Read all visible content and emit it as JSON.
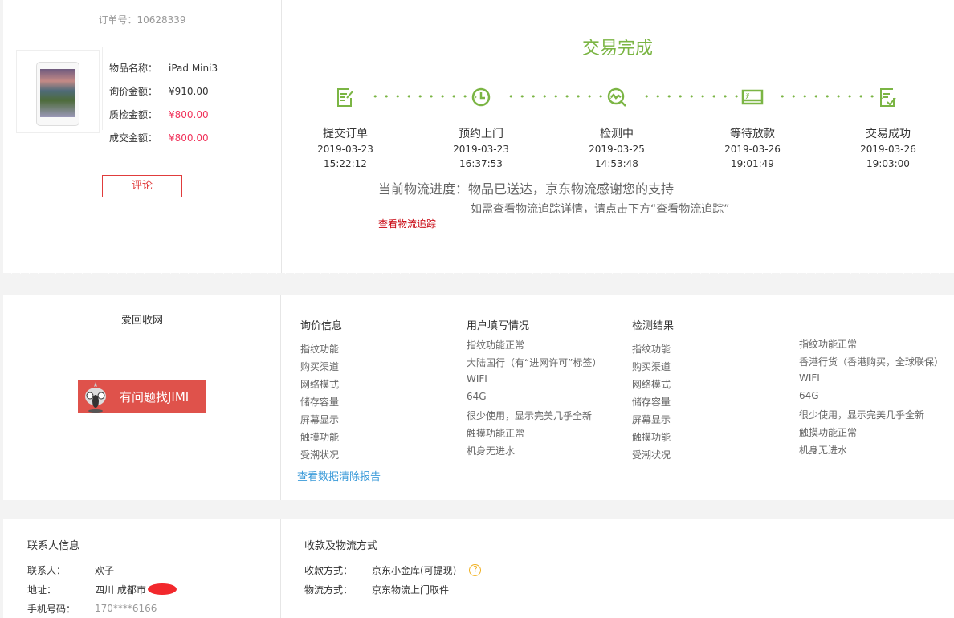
{
  "order": {
    "number_label": "订单号：10628339",
    "fields": [
      {
        "label": "物品名称：",
        "value": "iPad Mini3"
      },
      {
        "label": "询价金额：",
        "value": "¥910.00"
      },
      {
        "label": "质检金额：",
        "value": "¥800.00"
      },
      {
        "label": "成交金额：",
        "value": "¥800.00"
      }
    ],
    "comment_button": "评论"
  },
  "status": {
    "title": "交易完成",
    "steps": [
      {
        "label": "提交订单",
        "date": "2019-03-23",
        "time": "15:22:12",
        "icon": "edit-doc-icon"
      },
      {
        "label": "预约上门",
        "date": "2019-03-23",
        "time": "16:37:53",
        "icon": "clock-icon"
      },
      {
        "label": "检测中",
        "date": "2019-03-25",
        "time": "14:53:48",
        "icon": "inspect-icon"
      },
      {
        "label": "等待放款",
        "date": "2019-03-26",
        "time": "19:01:49",
        "icon": "card-icon"
      },
      {
        "label": "交易成功",
        "date": "2019-03-26",
        "time": "19:03:00",
        "icon": "check-doc-icon"
      }
    ],
    "logistics": "当前物流进度：物品已送达，京东物流感谢您的支持",
    "hint": "如需查看物流追踪详情，请点击下方“查看物流追踪”",
    "track_link": "查看物流追踪",
    "accent": "#7bb544"
  },
  "site": {
    "name": "爱回收网",
    "jimi_button": "有问题找JIMI"
  },
  "inspection": {
    "inquiry": {
      "title": "询价信息",
      "items": [
        "指纹功能",
        "购买渠道",
        "网络模式",
        "储存容量",
        "屏幕显示",
        "触摸功能",
        "受潮状况"
      ]
    },
    "user": {
      "title": "用户填写情况",
      "items": [
        "指纹功能正常",
        "大陆国行（有“进网许可”标签）",
        "WIFI",
        "64G",
        "很少使用，显示完美几乎全新",
        "触摸功能正常",
        "机身无进水"
      ]
    },
    "result": {
      "title": "检测结果",
      "items": [
        "指纹功能",
        "购买渠道",
        "网络模式",
        "储存容量",
        "屏幕显示",
        "触摸功能",
        "受潮状况"
      ]
    },
    "result_values": [
      "指纹功能正常",
      "香港行货（香港购买，全球联保）",
      "WIFI",
      "64G",
      "很少使用，显示完美几乎全新",
      "触摸功能正常",
      "机身无进水"
    ],
    "report_link": "查看数据清除报告"
  },
  "contact": {
    "title": "联系人信息",
    "name_label": "联系人：",
    "name": "欢子",
    "address_label": "地址：",
    "address": "四川 成都市",
    "phone_label": "手机号码：",
    "phone": "170****6166"
  },
  "payment": {
    "title": "收款及物流方式",
    "pay_label": "收款方式：",
    "pay": "京东小金库(可提现)",
    "ship_label": "物流方式：",
    "ship": "京东物流上门取件"
  }
}
